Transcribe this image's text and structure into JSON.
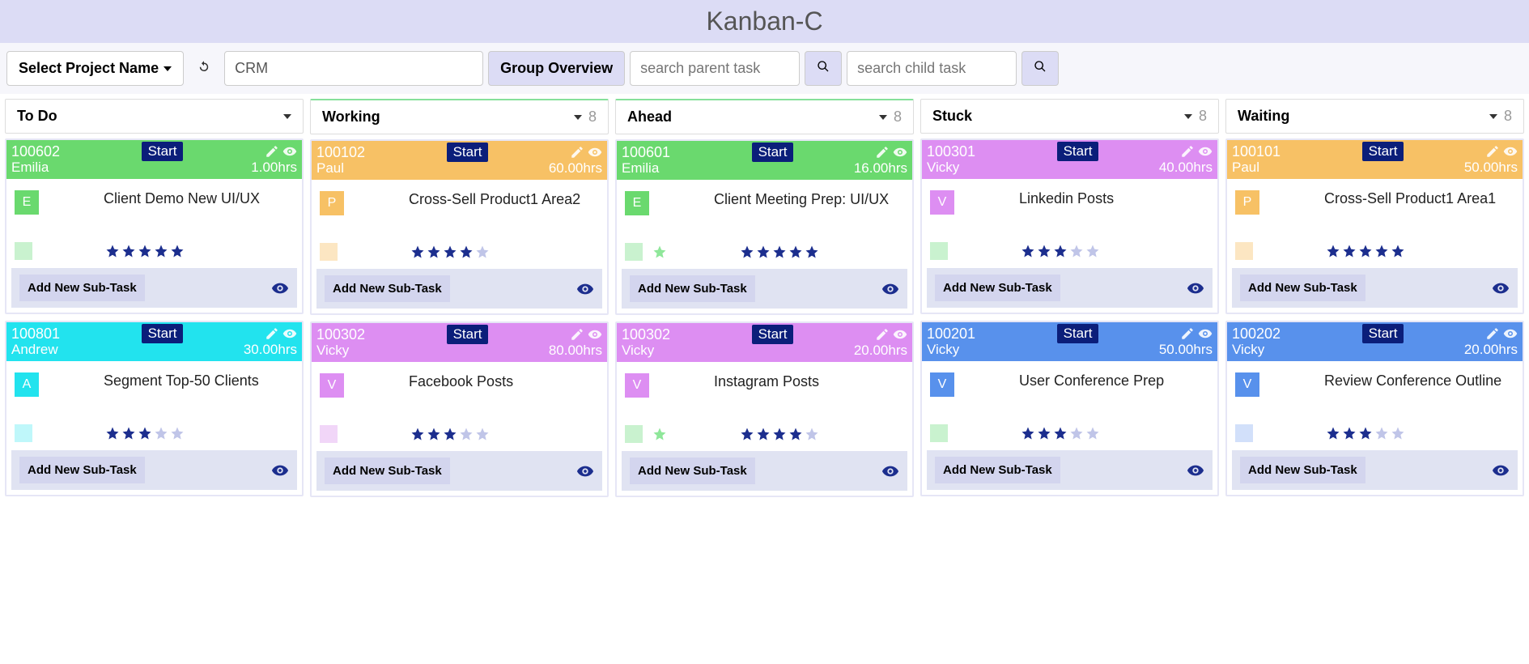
{
  "app_title": "Kanban-C",
  "toolbar": {
    "project_selector_label": "Select Project Name",
    "project_value": "CRM",
    "group_overview_label": "Group Overview",
    "search_parent_placeholder": "search parent task",
    "search_child_placeholder": "search child task"
  },
  "subtask_label": "Add New Sub-Task",
  "start_label": "Start",
  "columns": [
    {
      "title": "To Do",
      "count": "",
      "accent": "none",
      "cards": [
        {
          "id": "100602",
          "owner": "Emilia",
          "hours": "1.00hrs",
          "color": "green",
          "avatar": "E",
          "title": "Client Demo New UI/UX",
          "stars": 5,
          "green_star": false,
          "mini": "green-light"
        },
        {
          "id": "100801",
          "owner": "Andrew",
          "hours": "30.00hrs",
          "color": "cyan",
          "avatar": "A",
          "title": "Segment Top-50 Clients",
          "stars": 3,
          "green_star": false,
          "mini": "cyan-light"
        }
      ]
    },
    {
      "title": "Working",
      "count": "8",
      "accent": "green",
      "cards": [
        {
          "id": "100102",
          "owner": "Paul",
          "hours": "60.00hrs",
          "color": "orange",
          "avatar": "P",
          "title": "Cross-Sell Product1 Area2",
          "stars": 4,
          "green_star": false,
          "mini": "orange-light"
        },
        {
          "id": "100302",
          "owner": "Vicky",
          "hours": "80.00hrs",
          "color": "pink",
          "avatar": "V",
          "title": "Facebook Posts",
          "stars": 3,
          "green_star": false,
          "mini": "pink-light"
        }
      ]
    },
    {
      "title": "Ahead",
      "count": "8",
      "accent": "green",
      "cards": [
        {
          "id": "100601",
          "owner": "Emilia",
          "hours": "16.00hrs",
          "color": "green",
          "avatar": "E",
          "title": "Client Meeting Prep: UI/UX",
          "stars": 5,
          "green_star": true,
          "mini": "green-light"
        },
        {
          "id": "100302",
          "owner": "Vicky",
          "hours": "20.00hrs",
          "color": "pink",
          "avatar": "V",
          "title": "Instagram Posts",
          "stars": 4,
          "green_star": true,
          "mini": "green-light"
        }
      ]
    },
    {
      "title": "Stuck",
      "count": "8",
      "accent": "none",
      "cards": [
        {
          "id": "100301",
          "owner": "Vicky",
          "hours": "40.00hrs",
          "color": "pink",
          "avatar": "V",
          "title": "Linkedin Posts",
          "stars": 3,
          "green_star": false,
          "mini": "green-light"
        },
        {
          "id": "100201",
          "owner": "Vicky",
          "hours": "50.00hrs",
          "color": "blue",
          "avatar": "V",
          "title": "User Conference Prep",
          "stars": 3,
          "green_star": false,
          "mini": "green-light"
        }
      ]
    },
    {
      "title": "Waiting",
      "count": "8",
      "accent": "none",
      "cards": [
        {
          "id": "100101",
          "owner": "Paul",
          "hours": "50.00hrs",
          "color": "orange",
          "avatar": "P",
          "title": "Cross-Sell Product1 Area1",
          "stars": 5,
          "green_star": false,
          "mini": "orange-light"
        },
        {
          "id": "100202",
          "owner": "Vicky",
          "hours": "20.00hrs",
          "color": "blue",
          "avatar": "V",
          "title": "Review Conference Outline",
          "stars": 3,
          "green_star": false,
          "mini": "blue-light"
        }
      ]
    }
  ]
}
